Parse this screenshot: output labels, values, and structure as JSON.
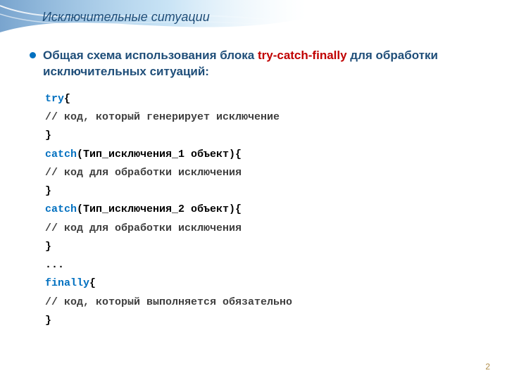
{
  "slide": {
    "title": "Исключительные ситуации",
    "intro_pre": "Общая схема использования блока ",
    "intro_red": "try-catch-finally",
    "intro_post": " для обработки исключительных ситуаций:",
    "code": {
      "l0_kw": "try",
      "l0_brace": "{",
      "l1": "// код, который генерирует исключение",
      "l2": "}",
      "l3_kw": "catch",
      "l3_args": "(Тип_исключения_1 объект){",
      "l4": "// код для обработки исключения",
      "l5": "}",
      "l6_kw": "catch",
      "l6_args": "(Тип_исключения_2 объект){",
      "l7": "// код для обработки исключения",
      "l8": "}",
      "l9": "...",
      "l10_kw": "finally",
      "l10_brace": "{",
      "l11": "// код, который выполняется обязательно",
      "l12": "}"
    },
    "page_number": "2"
  }
}
